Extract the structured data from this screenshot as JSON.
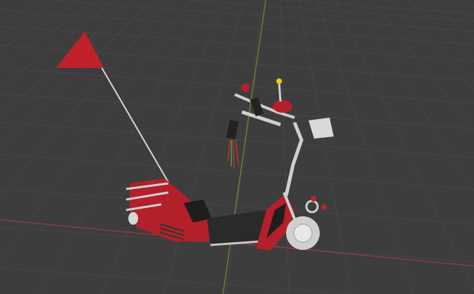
{
  "viewport": {
    "type": "3d-viewport",
    "object": "scooter-model-with-flag",
    "colors": {
      "background": "#3d3d3d",
      "grid": "#4a4a4a",
      "x_axis": "#9a3a48",
      "y_axis": "#6e8a2a",
      "body_red": "#b3202a",
      "body_dark": "#222222",
      "chrome": "#c8c8c8",
      "flag": "#c0212b"
    }
  }
}
